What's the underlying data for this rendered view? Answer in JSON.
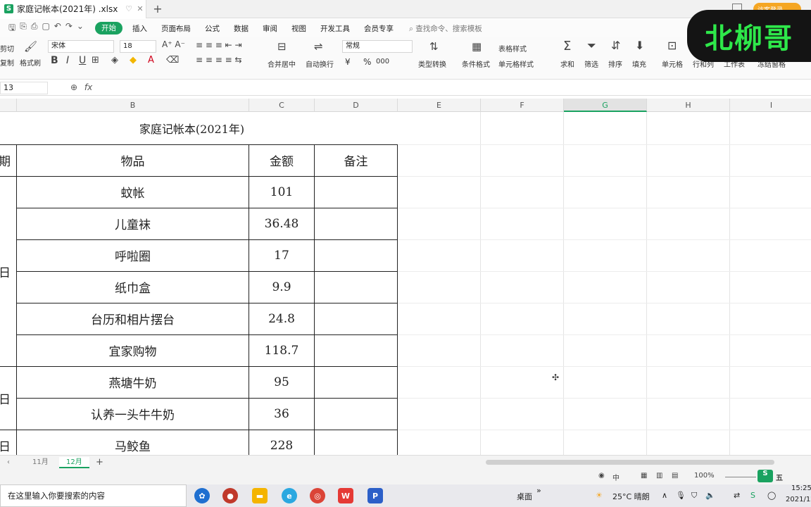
{
  "window": {
    "doc_title": "家庭记帐本(2021年) .xlsx",
    "doc_icon": "S",
    "login_label": "访客登录"
  },
  "menu": {
    "items": [
      "开始",
      "插入",
      "页面布局",
      "公式",
      "数据",
      "审阅",
      "视图",
      "开发工具",
      "会员专享"
    ],
    "active_index": 0,
    "search_placeholder": "查找命令、搜索模板"
  },
  "ribbon": {
    "cut": "剪切",
    "copy": "复制",
    "format_painter": "格式刷",
    "font_name": "宋体",
    "font_size": "18",
    "merge": "合并居中",
    "wrap": "自动换行",
    "number_format": "常规",
    "percent": "%",
    "currency": "¥",
    "thousands": "000",
    "type_convert": "类型转换",
    "cond_format": "条件格式",
    "table_style": "表格样式",
    "cell_style": "单元格样式",
    "sum": "求和",
    "filter": "筛选",
    "sort": "排序",
    "fill": "填充",
    "cell": "单元格",
    "row_col": "行和列",
    "worksheet": "工作表",
    "freeze": "冻结窗格"
  },
  "watermark": "北柳哥",
  "formula_bar": {
    "name_box": "13",
    "fx": "fx"
  },
  "columns": [
    "B",
    "C",
    "D",
    "E",
    "F",
    "G",
    "H",
    "I"
  ],
  "selected_column": "G",
  "sheet": {
    "title": "家庭记帐本(2021年)",
    "headers": {
      "a": "期",
      "b": "物品",
      "c": "金额",
      "d": "备注"
    },
    "group_labels": [
      "日",
      "日",
      "日"
    ],
    "rows": [
      {
        "item": "蚊帐",
        "amount": "101",
        "note": ""
      },
      {
        "item": "儿童袜",
        "amount": "36.48",
        "note": ""
      },
      {
        "item": "呼啦圈",
        "amount": "17",
        "note": ""
      },
      {
        "item": "纸巾盒",
        "amount": "9.9",
        "note": ""
      },
      {
        "item": "台历和相片摆台",
        "amount": "24.8",
        "note": ""
      },
      {
        "item": "宜家购物",
        "amount": "118.7",
        "note": ""
      },
      {
        "item": "燕塘牛奶",
        "amount": "95",
        "note": ""
      },
      {
        "item": "认养一头牛牛奶",
        "amount": "36",
        "note": ""
      },
      {
        "item": "马鲛鱼",
        "amount": "228",
        "note": ""
      }
    ]
  },
  "sheet_tabs": [
    "11月",
    "12月"
  ],
  "active_sheet": "12月",
  "status": {
    "zoom": "100%",
    "input_mode": "中",
    "wps_mark": "五"
  },
  "taskbar": {
    "search_text": "在这里输入你要搜索的内容",
    "desktop": "桌面",
    "weather": "25°C 晴朗",
    "time": "15:25",
    "date": "2021/12"
  },
  "colors": {
    "wps_green": "#1aa260",
    "watermark_text": "#2ee84a"
  }
}
